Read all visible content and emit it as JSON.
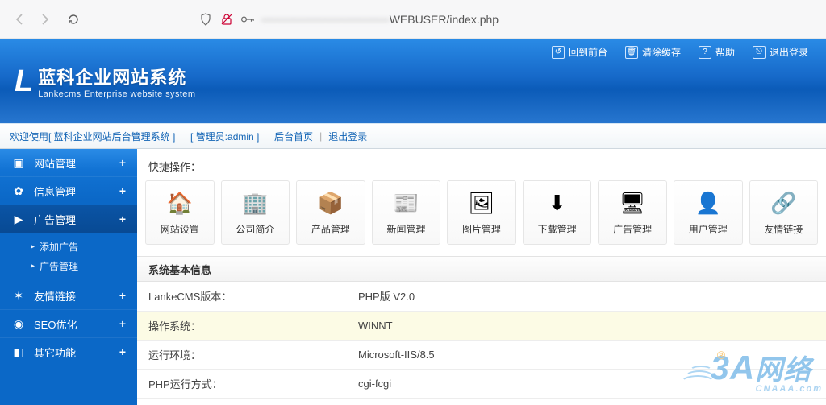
{
  "browser": {
    "url_blur": "────────────────",
    "url_clear": "WEBUSER/index.php"
  },
  "logo": {
    "cn": "蓝科企业网站系统",
    "en": "Lankecms Enterprise website system"
  },
  "top_actions": [
    {
      "icon": "↺",
      "label": "回到前台"
    },
    {
      "icon": "🗑",
      "label": "清除缓存"
    },
    {
      "icon": "?",
      "label": "帮助"
    },
    {
      "icon": "⎋",
      "label": "退出登录"
    }
  ],
  "crumb": {
    "welcome": "欢迎使用[ 蓝科企业网站后台管理系统 ]",
    "admin": "[ 管理员:admin ]",
    "home": "后台首页",
    "logout": "退出登录"
  },
  "sidebar": [
    {
      "icon": "▣",
      "label": "网站管理",
      "expand": "+",
      "name": "site-mgmt"
    },
    {
      "icon": "✿",
      "label": "信息管理",
      "expand": "+",
      "name": "info-mgmt"
    },
    {
      "icon": "▶",
      "label": "广告管理",
      "expand": "+",
      "name": "ad-mgmt",
      "active": true,
      "children": [
        {
          "label": "添加广告",
          "name": "add-ad"
        },
        {
          "label": "广告管理",
          "name": "manage-ad"
        }
      ]
    },
    {
      "icon": "✶",
      "label": "友情链接",
      "expand": "+",
      "name": "friend-links"
    },
    {
      "icon": "◉",
      "label": "SEO优化",
      "expand": "+",
      "name": "seo"
    },
    {
      "icon": "◧",
      "label": "其它功能",
      "expand": "+",
      "name": "other"
    }
  ],
  "quick": {
    "title": "快捷操作：",
    "items": [
      {
        "icon": "🏠",
        "label": "网站设置",
        "name": "site-settings"
      },
      {
        "icon": "🏢",
        "label": "公司简介",
        "name": "company-profile"
      },
      {
        "icon": "📦",
        "label": "产品管理",
        "name": "product-mgmt"
      },
      {
        "icon": "📰",
        "label": "新闻管理",
        "name": "news-mgmt"
      },
      {
        "icon": "🖼",
        "label": "图片管理",
        "name": "image-mgmt"
      },
      {
        "icon": "⬇",
        "label": "下载管理",
        "name": "download-mgmt"
      },
      {
        "icon": "🖥",
        "label": "广告管理",
        "name": "ad-mgmt-q"
      },
      {
        "icon": "👤",
        "label": "用户管理",
        "name": "user-mgmt"
      },
      {
        "icon": "🔗",
        "label": "友情链接",
        "name": "friend-links-q"
      }
    ]
  },
  "sysinfo": {
    "title": "系统基本信息",
    "rows": [
      {
        "k": "LankeCMS版本：",
        "v": "PHP版 V2.0"
      },
      {
        "k": "操作系统：",
        "v": "WINNT",
        "hl": true
      },
      {
        "k": "运行环境：",
        "v": "Microsoft-IIS/8.5"
      },
      {
        "k": "PHP运行方式：",
        "v": "cgi-fcgi"
      }
    ]
  },
  "watermark": {
    "main": "3A网络",
    "sub": "CNAAA.com",
    "dot": "®"
  }
}
